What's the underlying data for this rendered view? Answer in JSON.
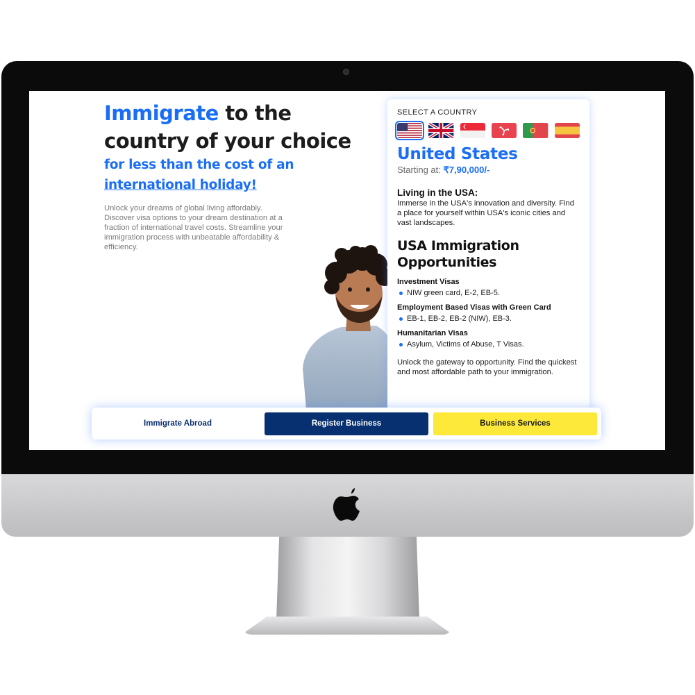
{
  "hero": {
    "title_accent": "Immigrate",
    "title_rest_1": " to the",
    "title_rest_2": "country of your choice",
    "subtitle_line1": "for less than the cost of an",
    "subtitle_line2": "international holiday!",
    "description": "Unlock your dreams of global living affordably. Discover visa options to your dream destination at a fraction of international travel costs. Streamline your immigration process with unbeatable affordability & efficiency."
  },
  "card": {
    "label": "SELECT A COUNTRY",
    "flags": [
      {
        "icon": "usa-flag-icon",
        "selected": true
      },
      {
        "icon": "uk-flag-icon",
        "selected": false
      },
      {
        "icon": "singapore-flag-icon",
        "selected": false
      },
      {
        "icon": "isle-of-man-flag-icon",
        "selected": false
      },
      {
        "icon": "portugal-flag-icon",
        "selected": false
      },
      {
        "icon": "spain-flag-icon",
        "selected": false
      }
    ],
    "country": "United States",
    "starting_label": "Starting at: ",
    "price": "₹7,90,000/-",
    "living_title": "Living in the USA:",
    "living_text": "Immerse in the USA's innovation and diversity. Find a place for yourself within USA's iconic cities and vast landscapes.",
    "opp_title": "USA Immigration Opportunities",
    "visa_groups": [
      {
        "head": "Investment Visas",
        "item": "NIW green card, E-2, EB-5."
      },
      {
        "head": "Employment Based Visas with Green Card",
        "item": "EB-1, EB-2, EB-2 (NIW), EB-3."
      },
      {
        "head": "Humanitarian Visas",
        "item": "Asylum, Victims of Abuse, T Visas."
      }
    ],
    "footer": "Unlock the gateway to opportunity. Find the quickest and most affordable path to your immigration."
  },
  "tabs": {
    "immigrate": "Immigrate Abroad",
    "register": "Register Business",
    "services": "Business Services"
  },
  "colors": {
    "accent": "#1a6ef5",
    "navy": "#06306f",
    "yellow": "#fde93a"
  }
}
